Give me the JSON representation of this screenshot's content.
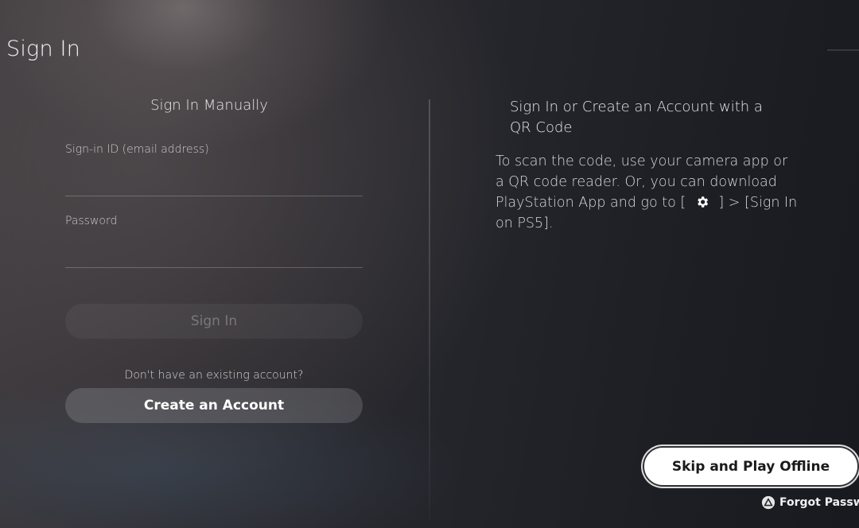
{
  "page": {
    "title": "Sign In"
  },
  "manual": {
    "title": "Sign In Manually",
    "signin_id_label": "Sign-in ID (email address)",
    "signin_id_value": "",
    "password_label": "Password",
    "password_value": "",
    "signin_button": "Sign In",
    "no_account_text": "Don't have an existing account?",
    "create_button": "Create an Account"
  },
  "qr": {
    "title": "Sign In or Create an Account with a QR Code",
    "desc_before_icon": "To scan the code, use your camera app or a QR code reader. Or, you can download PlayStation App and go to [",
    "inline_icon": "gear-icon",
    "desc_after_icon": "] > [Sign In on PS5]."
  },
  "actions": {
    "skip_button": "Skip and Play Offline",
    "forgot_icon": "triangle-button-icon",
    "forgot_label": "Forgot Password?"
  }
}
